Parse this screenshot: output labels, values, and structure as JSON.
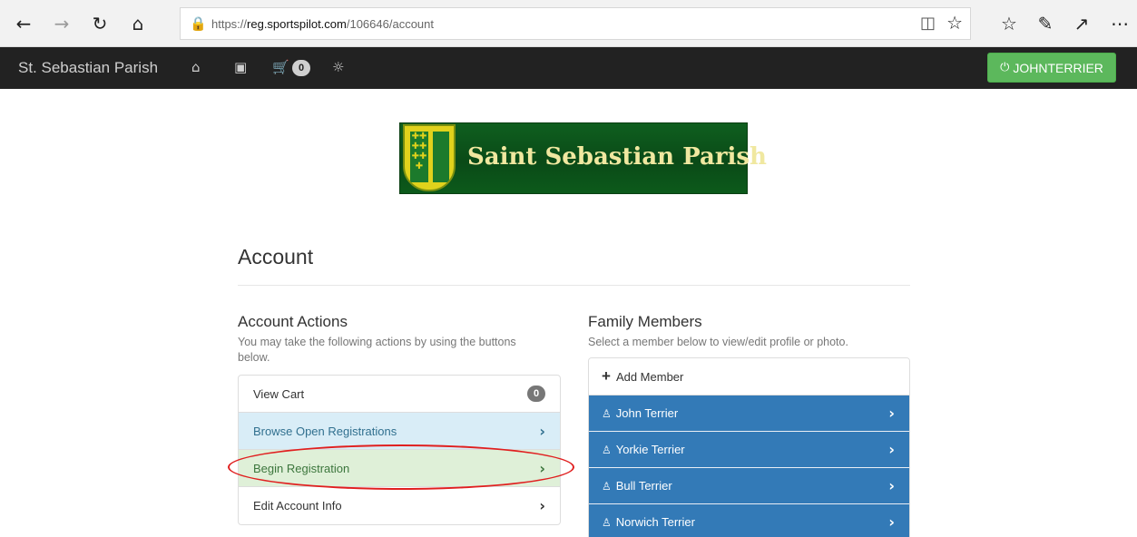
{
  "browser": {
    "url_prefix": "https://",
    "url_host": "reg.sportspilot.com",
    "url_path": "/106646/account",
    "icons": {
      "back": "back-arrow-icon",
      "forward": "forward-arrow-icon",
      "refresh": "refresh-icon",
      "home": "home-icon",
      "lock": "lock-icon",
      "reading_view": "reading-view-icon",
      "favorite": "star-icon",
      "favorites_hub": "favorites-hub-icon",
      "notes": "pen-icon",
      "share": "share-icon",
      "more": "more-icon"
    }
  },
  "navbar": {
    "brand": "St. Sebastian Parish",
    "cart_count": "0",
    "user_button": "JOHNTERRIER",
    "icons": [
      "home-icon",
      "inbox-icon",
      "cart-icon",
      "lifebuoy-icon",
      "power-icon"
    ]
  },
  "logo": {
    "text": "Saint Sebastian Parish"
  },
  "page": {
    "title": "Account"
  },
  "account_actions": {
    "title": "Account Actions",
    "help": "You may take the following actions by using the buttons below.",
    "items": [
      {
        "label": "View Cart",
        "badge": "0"
      },
      {
        "label": "Browse Open Registrations"
      },
      {
        "label": "Begin Registration"
      },
      {
        "label": "Edit Account Info"
      }
    ]
  },
  "family_members": {
    "title": "Family Members",
    "help": "Select a member below to view/edit profile or photo.",
    "add_label": "Add Member",
    "members": [
      {
        "name": "John Terrier"
      },
      {
        "name": "Yorkie Terrier"
      },
      {
        "name": "Bull Terrier"
      },
      {
        "name": "Norwich Terrier"
      }
    ]
  },
  "colors": {
    "navbar": "#222222",
    "user_button": "#5cb85c",
    "member_item": "#337ab7",
    "highlight_ring": "#e01f1f",
    "info_item": "#d9edf7",
    "success_item": "#dff0d8"
  }
}
